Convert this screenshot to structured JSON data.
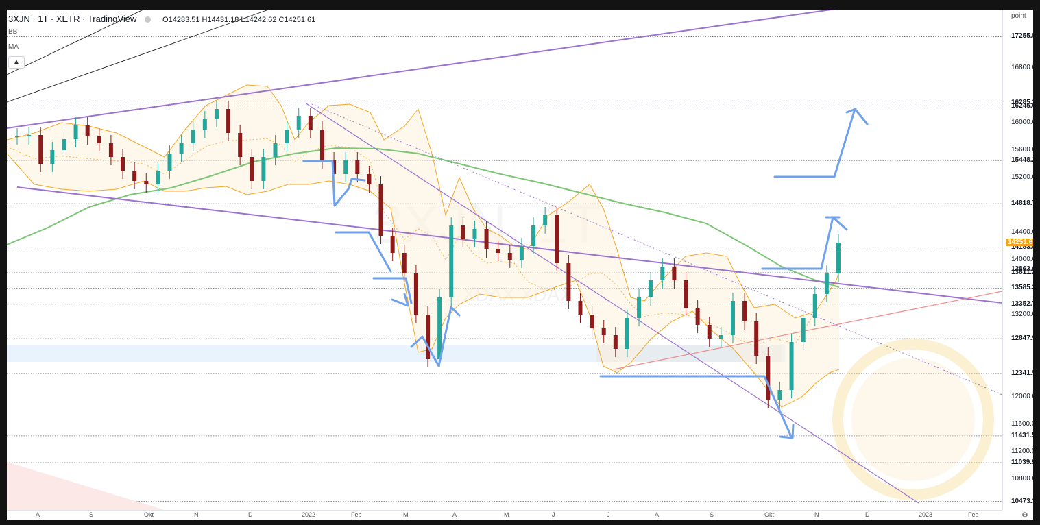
{
  "header": {
    "symbol": "3XJN · 1T · XETR · TradingView",
    "ohlc": "O14283.51  H14431.18  L14242.62  C14251.61",
    "indicators": [
      "BB",
      "MA"
    ],
    "collapse_icon": "chevron-up-icon"
  },
  "watermark": {
    "title": "3XJN, 1T",
    "subtitle": "XDAX  XDAX"
  },
  "price_axis": {
    "unit": "point",
    "labels": [
      {
        "text": "17255.5",
        "value": 17255.5,
        "marked": true
      },
      {
        "text": "16800.0",
        "value": 16800,
        "marked": false
      },
      {
        "text": "16285.3",
        "value": 16285.3,
        "marked": true
      },
      {
        "text": "16245.0",
        "value": 16245,
        "marked": true
      },
      {
        "text": "16000.0",
        "value": 16000,
        "marked": false
      },
      {
        "text": "15600.0",
        "value": 15600,
        "marked": false
      },
      {
        "text": "15448.2",
        "value": 15448.2,
        "marked": true
      },
      {
        "text": "15200.0",
        "value": 15200,
        "marked": false
      },
      {
        "text": "14818.7",
        "value": 14818.7,
        "marked": true
      },
      {
        "text": "14400.0",
        "value": 14400,
        "marked": false
      },
      {
        "text": "14183.5",
        "value": 14183.5,
        "marked": true
      },
      {
        "text": "14000.0",
        "value": 14000,
        "marked": false
      },
      {
        "text": "13863.6",
        "value": 13863.6,
        "marked": true
      },
      {
        "text": "13811.2",
        "value": 13811.2,
        "marked": true
      },
      {
        "text": "13585.3",
        "value": 13585.3,
        "marked": true
      },
      {
        "text": "13352.7",
        "value": 13352.7,
        "marked": true
      },
      {
        "text": "13200.0",
        "value": 13200,
        "marked": false
      },
      {
        "text": "12847.9",
        "value": 12847.9,
        "marked": true
      },
      {
        "text": "12341.5",
        "value": 12341.5,
        "marked": true
      },
      {
        "text": "12000.0",
        "value": 12000,
        "marked": false
      },
      {
        "text": "11600.0",
        "value": 11600,
        "marked": false
      },
      {
        "text": "11431.5",
        "value": 11431.5,
        "marked": true
      },
      {
        "text": "11200.0",
        "value": 11200,
        "marked": false
      },
      {
        "text": "11039.9",
        "value": 11039.9,
        "marked": true
      },
      {
        "text": "10800.0",
        "value": 10800,
        "marked": false
      },
      {
        "text": "10473.3",
        "value": 10473.3,
        "marked": true
      }
    ],
    "current": {
      "text": "14251.6",
      "value": 14251.6
    }
  },
  "time_axis": {
    "labels": [
      "A",
      "S",
      "Okt",
      "N",
      "D",
      "2022",
      "Feb",
      "M",
      "A",
      "M",
      "J",
      "J",
      "A",
      "S",
      "Okt",
      "N",
      "D",
      "2023",
      "Feb"
    ],
    "settings_icon": "gear-icon"
  },
  "colors": {
    "up": "#26a69a",
    "down": "#8e1b1b",
    "bb": "#f5a623",
    "ma": "#7cc576",
    "channel": "#9b72cf",
    "arrows": "#6fa1ec",
    "support": "#ef8b8b",
    "current": "#f7a21b"
  },
  "chart_data": {
    "type": "candlestick",
    "series_close": [
      15800,
      15820,
      15400,
      15600,
      15760,
      15960,
      15800,
      15700,
      15500,
      15300,
      15150,
      15100,
      15300,
      15550,
      15700,
      15900,
      16050,
      16200,
      15850,
      15500,
      15150,
      15500,
      15700,
      15900,
      16100,
      15900,
      15450,
      15250,
      15450,
      15250,
      15100,
      14350,
      14100,
      13800,
      13200,
      12550,
      13450,
      14500,
      14300,
      14450,
      14150,
      14100,
      14000,
      14200,
      14500,
      14650,
      13950,
      13400,
      13200,
      13000,
      12900,
      12700,
      13150,
      13450,
      13700,
      13900,
      13700,
      13300,
      13050,
      12850,
      12900,
      13400,
      13100,
      12600,
      11950,
      12100,
      12800,
      13150,
      13500,
      13800,
      14250
    ],
    "ylim": [
      10350,
      17650
    ]
  }
}
